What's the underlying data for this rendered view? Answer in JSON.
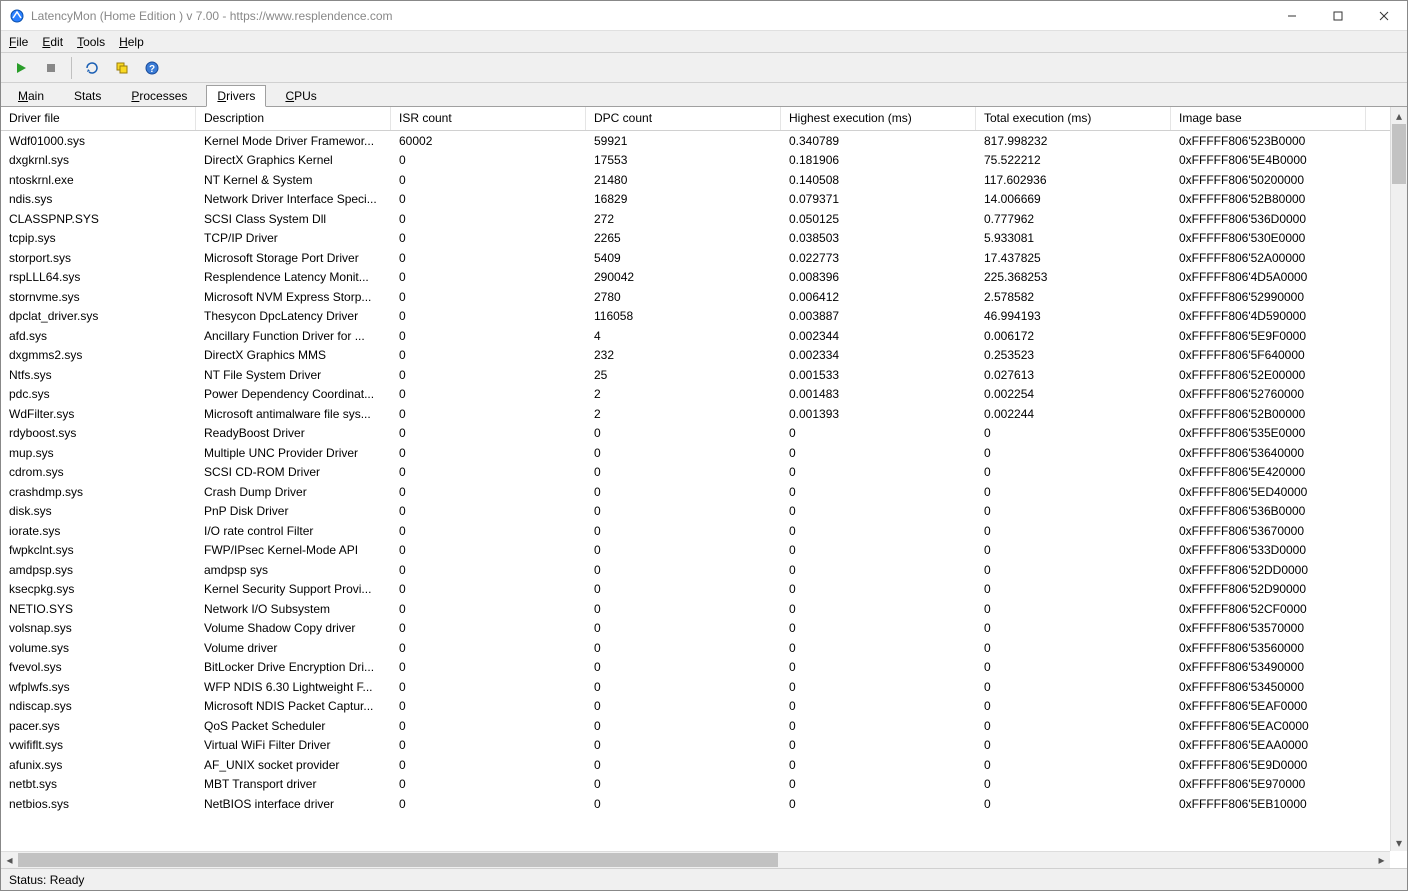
{
  "window": {
    "title": "LatencyMon  (Home Edition )  v 7.00 - https://www.resplendence.com"
  },
  "menu": {
    "file": "File",
    "edit": "Edit",
    "tools": "Tools",
    "help": "Help"
  },
  "tabs": {
    "main": "Main",
    "stats": "Stats",
    "processes": "Processes",
    "drivers": "Drivers",
    "cpus": "CPUs",
    "active": "drivers"
  },
  "table": {
    "columns": [
      "Driver file",
      "Description",
      "ISR count",
      "DPC count",
      "Highest execution (ms)",
      "Total execution (ms)",
      "Image base"
    ],
    "rows": [
      [
        "Wdf01000.sys",
        "Kernel Mode Driver Framewor...",
        "60002",
        "59921",
        "0.340789",
        "817.998232",
        "0xFFFFF806'523B0000"
      ],
      [
        "dxgkrnl.sys",
        "DirectX Graphics Kernel",
        "0",
        "17553",
        "0.181906",
        "75.522212",
        "0xFFFFF806'5E4B0000"
      ],
      [
        "ntoskrnl.exe",
        "NT Kernel & System",
        "0",
        "21480",
        "0.140508",
        "117.602936",
        "0xFFFFF806'50200000"
      ],
      [
        "ndis.sys",
        "Network Driver Interface Speci...",
        "0",
        "16829",
        "0.079371",
        "14.006669",
        "0xFFFFF806'52B80000"
      ],
      [
        "CLASSPNP.SYS",
        "SCSI Class System Dll",
        "0",
        "272",
        "0.050125",
        "0.777962",
        "0xFFFFF806'536D0000"
      ],
      [
        "tcpip.sys",
        "TCP/IP Driver",
        "0",
        "2265",
        "0.038503",
        "5.933081",
        "0xFFFFF806'530E0000"
      ],
      [
        "storport.sys",
        "Microsoft Storage Port Driver",
        "0",
        "5409",
        "0.022773",
        "17.437825",
        "0xFFFFF806'52A00000"
      ],
      [
        "rspLLL64.sys",
        "Resplendence Latency Monit...",
        "0",
        "290042",
        "0.008396",
        "225.368253",
        "0xFFFFF806'4D5A0000"
      ],
      [
        "stornvme.sys",
        "Microsoft NVM Express Storp...",
        "0",
        "2780",
        "0.006412",
        "2.578582",
        "0xFFFFF806'52990000"
      ],
      [
        "dpclat_driver.sys",
        "Thesycon DpcLatency Driver",
        "0",
        "116058",
        "0.003887",
        "46.994193",
        "0xFFFFF806'4D590000"
      ],
      [
        "afd.sys",
        "Ancillary Function Driver for ...",
        "0",
        "4",
        "0.002344",
        "0.006172",
        "0xFFFFF806'5E9F0000"
      ],
      [
        "dxgmms2.sys",
        "DirectX Graphics MMS",
        "0",
        "232",
        "0.002334",
        "0.253523",
        "0xFFFFF806'5F640000"
      ],
      [
        "Ntfs.sys",
        "NT File System Driver",
        "0",
        "25",
        "0.001533",
        "0.027613",
        "0xFFFFF806'52E00000"
      ],
      [
        "pdc.sys",
        "Power Dependency Coordinat...",
        "0",
        "2",
        "0.001483",
        "0.002254",
        "0xFFFFF806'52760000"
      ],
      [
        "WdFilter.sys",
        "Microsoft antimalware file sys...",
        "0",
        "2",
        "0.001393",
        "0.002244",
        "0xFFFFF806'52B00000"
      ],
      [
        "rdyboost.sys",
        "ReadyBoost Driver",
        "0",
        "0",
        "0",
        "0",
        "0xFFFFF806'535E0000"
      ],
      [
        "mup.sys",
        "Multiple UNC Provider Driver",
        "0",
        "0",
        "0",
        "0",
        "0xFFFFF806'53640000"
      ],
      [
        "cdrom.sys",
        "SCSI CD-ROM Driver",
        "0",
        "0",
        "0",
        "0",
        "0xFFFFF806'5E420000"
      ],
      [
        "crashdmp.sys",
        "Crash Dump Driver",
        "0",
        "0",
        "0",
        "0",
        "0xFFFFF806'5ED40000"
      ],
      [
        "disk.sys",
        "PnP Disk Driver",
        "0",
        "0",
        "0",
        "0",
        "0xFFFFF806'536B0000"
      ],
      [
        "iorate.sys",
        "I/O rate control Filter",
        "0",
        "0",
        "0",
        "0",
        "0xFFFFF806'53670000"
      ],
      [
        "fwpkclnt.sys",
        "FWP/IPsec Kernel-Mode API",
        "0",
        "0",
        "0",
        "0",
        "0xFFFFF806'533D0000"
      ],
      [
        "amdpsp.sys",
        "amdpsp sys",
        "0",
        "0",
        "0",
        "0",
        "0xFFFFF806'52DD0000"
      ],
      [
        "ksecpkg.sys",
        "Kernel Security Support Provi...",
        "0",
        "0",
        "0",
        "0",
        "0xFFFFF806'52D90000"
      ],
      [
        "NETIO.SYS",
        "Network I/O Subsystem",
        "0",
        "0",
        "0",
        "0",
        "0xFFFFF806'52CF0000"
      ],
      [
        "volsnap.sys",
        "Volume Shadow Copy driver",
        "0",
        "0",
        "0",
        "0",
        "0xFFFFF806'53570000"
      ],
      [
        "volume.sys",
        "Volume driver",
        "0",
        "0",
        "0",
        "0",
        "0xFFFFF806'53560000"
      ],
      [
        "fvevol.sys",
        "BitLocker Drive Encryption Dri...",
        "0",
        "0",
        "0",
        "0",
        "0xFFFFF806'53490000"
      ],
      [
        "wfplwfs.sys",
        "WFP NDIS 6.30 Lightweight F...",
        "0",
        "0",
        "0",
        "0",
        "0xFFFFF806'53450000"
      ],
      [
        "ndiscap.sys",
        "Microsoft NDIS Packet Captur...",
        "0",
        "0",
        "0",
        "0",
        "0xFFFFF806'5EAF0000"
      ],
      [
        "pacer.sys",
        "QoS Packet Scheduler",
        "0",
        "0",
        "0",
        "0",
        "0xFFFFF806'5EAC0000"
      ],
      [
        "vwififlt.sys",
        "Virtual WiFi Filter Driver",
        "0",
        "0",
        "0",
        "0",
        "0xFFFFF806'5EAA0000"
      ],
      [
        "afunix.sys",
        "AF_UNIX socket provider",
        "0",
        "0",
        "0",
        "0",
        "0xFFFFF806'5E9D0000"
      ],
      [
        "netbt.sys",
        "MBT Transport driver",
        "0",
        "0",
        "0",
        "0",
        "0xFFFFF806'5E970000"
      ],
      [
        "netbios.sys",
        "NetBIOS interface driver",
        "0",
        "0",
        "0",
        "0",
        "0xFFFFF806'5EB10000"
      ]
    ]
  },
  "status": {
    "text": "Status: Ready"
  }
}
